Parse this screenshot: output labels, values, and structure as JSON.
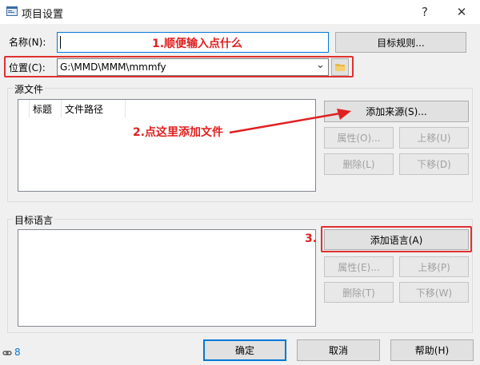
{
  "window": {
    "title": "项目设置",
    "help_glyph": "?",
    "close_glyph": "✕"
  },
  "name_field": {
    "label": "名称(N):",
    "value": "",
    "rules_button": "目标规则..."
  },
  "location_field": {
    "label": "位置(C):",
    "value": "G:\\MMD\\MMM\\mmmfy",
    "dropdown_glyph": "⌄"
  },
  "source_group": {
    "title": "源文件",
    "columns": [
      "标题",
      "文件路径"
    ],
    "buttons": {
      "add": "添加来源(S)...",
      "properties": "属性(O)...",
      "move_up": "上移(U)",
      "delete": "删除(L)",
      "move_down": "下移(D)"
    }
  },
  "language_group": {
    "title": "目标语言",
    "buttons": {
      "add": "添加语言(A)",
      "properties": "属性(E)...",
      "move_up": "上移(P)",
      "delete": "删除(T)",
      "move_down": "下移(W)"
    }
  },
  "footer": {
    "ok": "确定",
    "cancel": "取消",
    "help": "帮助(H)",
    "status_count": "8"
  },
  "annotations": {
    "step1": "1.顺便输入点什么",
    "step2": "2.点这里添加文件",
    "step3": "3."
  },
  "colors": {
    "annotation": "#e02020",
    "accent": "#0078d7"
  }
}
